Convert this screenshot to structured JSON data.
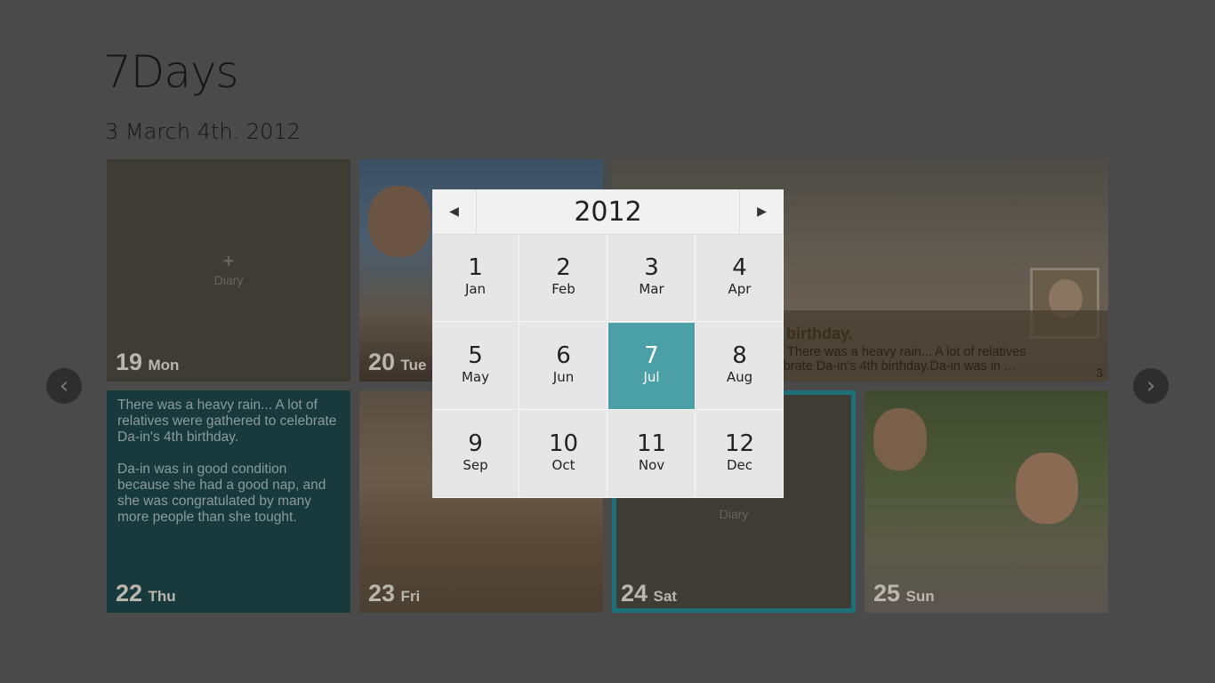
{
  "app": {
    "title": "7Days",
    "subtitle": "3 March 4th. 2012"
  },
  "colors": {
    "accent": "#4ba0a7",
    "text_tile": "#193a3c",
    "overlay_bg": "#4a4a4a"
  },
  "tiles": [
    {
      "day": "19",
      "weekday": "Mon",
      "type": "empty",
      "add_label": "Diary",
      "add_icon": "plus-icon"
    },
    {
      "day": "20",
      "weekday": "Tue",
      "type": "photo"
    },
    {
      "type": "photo-story",
      "title": "birthday.",
      "text": "rthday. There was a heavy rain... A lot of relatives\n to celebrate Da-in's 4th birthday.Da-in was in ...",
      "count": "3"
    },
    {
      "day": "22",
      "weekday": "Thu",
      "type": "text",
      "para1": "There was a heavy rain... A lot of relatives were gathered to celebrate Da-in's 4th birthday.",
      "para2": "Da-in was in good condition because she had a good nap, and she was congratulated by many more people than she tought."
    },
    {
      "day": "23",
      "weekday": "Fri",
      "type": "photo"
    },
    {
      "day": "24",
      "weekday": "Sat",
      "type": "empty",
      "add_label": "Diary"
    },
    {
      "day": "25",
      "weekday": "Sun",
      "type": "photo"
    }
  ],
  "nav": {
    "prev_icon": "chevron-left-icon",
    "next_icon": "chevron-right-icon",
    "prev_glyph": "‹",
    "next_glyph": "›"
  },
  "picker": {
    "year": "2012",
    "prev_glyph": "◀",
    "next_glyph": "▶",
    "selected_month": 7,
    "months": [
      {
        "num": "1",
        "label": "Jan"
      },
      {
        "num": "2",
        "label": "Feb"
      },
      {
        "num": "3",
        "label": "Mar"
      },
      {
        "num": "4",
        "label": "Apr"
      },
      {
        "num": "5",
        "label": "May"
      },
      {
        "num": "6",
        "label": "Jun"
      },
      {
        "num": "7",
        "label": "Jul"
      },
      {
        "num": "8",
        "label": "Aug"
      },
      {
        "num": "9",
        "label": "Sep"
      },
      {
        "num": "10",
        "label": "Oct"
      },
      {
        "num": "11",
        "label": "Nov"
      },
      {
        "num": "12",
        "label": "Dec"
      }
    ]
  }
}
